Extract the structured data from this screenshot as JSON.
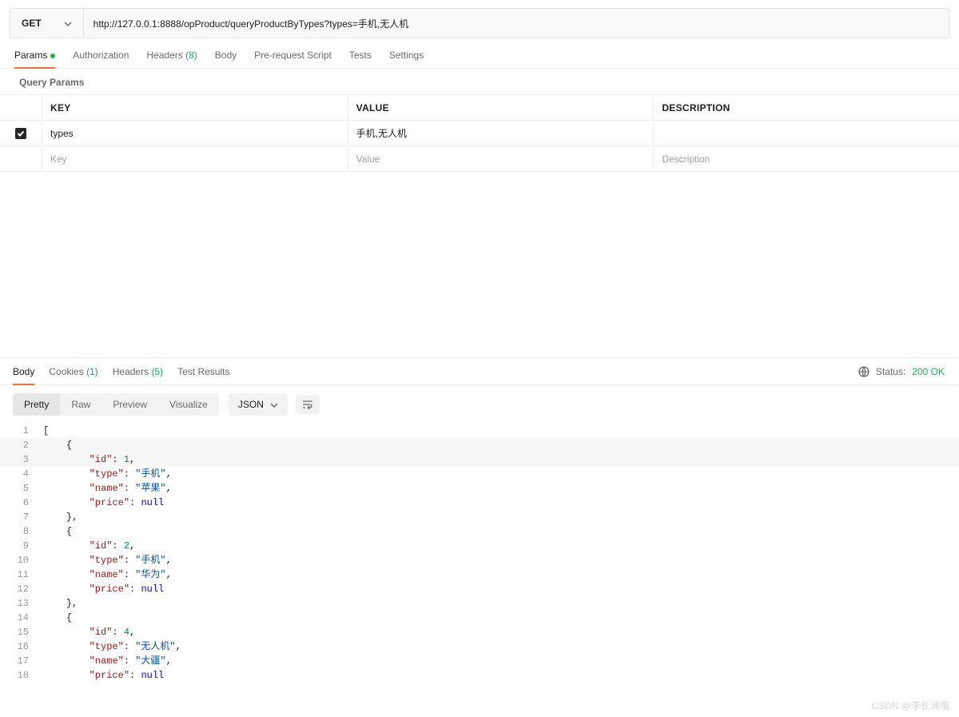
{
  "request": {
    "method": "GET",
    "url": "http://127.0.0.1:8888/opProduct/queryProductByTypes?types=手机,无人机"
  },
  "requestTabs": {
    "params": "Params",
    "authorization": "Authorization",
    "headers": "Headers",
    "headers_count": "(8)",
    "body": "Body",
    "prerequest": "Pre-request Script",
    "tests": "Tests",
    "settings": "Settings"
  },
  "queryParams": {
    "section_label": "Query Params",
    "columns": {
      "key": "KEY",
      "value": "VALUE",
      "description": "DESCRIPTION"
    },
    "rows": [
      {
        "enabled": true,
        "key": "types",
        "value": "手机,无人机",
        "description": ""
      }
    ],
    "placeholders": {
      "key": "Key",
      "value": "Value",
      "description": "Description"
    }
  },
  "responseTabs": {
    "body": "Body",
    "cookies": "Cookies",
    "cookies_count": "(1)",
    "headers": "Headers",
    "headers_count": "(5)",
    "testresults": "Test Results",
    "status_label": "Status:",
    "status_value": "200 OK"
  },
  "viewer": {
    "pretty": "Pretty",
    "raw": "Raw",
    "preview": "Preview",
    "visualize": "Visualize",
    "format": "JSON"
  },
  "responseBody": [
    {
      "n": 1,
      "indent": 0,
      "t": "punc",
      "text": "["
    },
    {
      "n": 2,
      "indent": 1,
      "t": "punc",
      "text": "{",
      "hl": true
    },
    {
      "n": 3,
      "indent": 2,
      "t": "kv",
      "key": "id",
      "vtype": "num",
      "value": "1",
      "comma": true,
      "hl": true
    },
    {
      "n": 4,
      "indent": 2,
      "t": "kv",
      "key": "type",
      "vtype": "str",
      "value": "手机",
      "comma": true
    },
    {
      "n": 5,
      "indent": 2,
      "t": "kv",
      "key": "name",
      "vtype": "str",
      "value": "苹果",
      "comma": true
    },
    {
      "n": 6,
      "indent": 2,
      "t": "kv",
      "key": "price",
      "vtype": "null",
      "value": "null",
      "comma": false
    },
    {
      "n": 7,
      "indent": 1,
      "t": "punc",
      "text": "},"
    },
    {
      "n": 8,
      "indent": 1,
      "t": "punc",
      "text": "{"
    },
    {
      "n": 9,
      "indent": 2,
      "t": "kv",
      "key": "id",
      "vtype": "num",
      "value": "2",
      "comma": true
    },
    {
      "n": 10,
      "indent": 2,
      "t": "kv",
      "key": "type",
      "vtype": "str",
      "value": "手机",
      "comma": true
    },
    {
      "n": 11,
      "indent": 2,
      "t": "kv",
      "key": "name",
      "vtype": "str",
      "value": "华为",
      "comma": true
    },
    {
      "n": 12,
      "indent": 2,
      "t": "kv",
      "key": "price",
      "vtype": "null",
      "value": "null",
      "comma": false
    },
    {
      "n": 13,
      "indent": 1,
      "t": "punc",
      "text": "},"
    },
    {
      "n": 14,
      "indent": 1,
      "t": "punc",
      "text": "{"
    },
    {
      "n": 15,
      "indent": 2,
      "t": "kv",
      "key": "id",
      "vtype": "num",
      "value": "4",
      "comma": true
    },
    {
      "n": 16,
      "indent": 2,
      "t": "kv",
      "key": "type",
      "vtype": "str",
      "value": "无人机",
      "comma": true
    },
    {
      "n": 17,
      "indent": 2,
      "t": "kv",
      "key": "name",
      "vtype": "str",
      "value": "大疆",
      "comma": true
    },
    {
      "n": 18,
      "indent": 2,
      "t": "kv",
      "key": "price",
      "vtype": "null",
      "value": "null",
      "comma": false
    }
  ],
  "watermark": "CSDN @李长渊哦"
}
